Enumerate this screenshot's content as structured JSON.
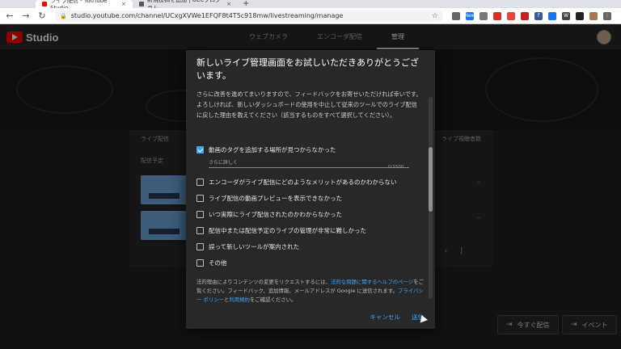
{
  "browser": {
    "tabs": [
      {
        "title": "ライブ配信 - YouTube Studio",
        "favicon_color": "#ff0000"
      },
      {
        "title": "新規投稿を追加 | UECプログラム",
        "favicon_color": "#555555"
      }
    ],
    "url": "studio.youtube.com/channel/UCxgXVWe1EFQF8t4T5c918mw/livestreaming/manage",
    "extension_icons": [
      {
        "name": "camera-icon",
        "color": "#666666",
        "text": ""
      },
      {
        "name": "new-badge-icon",
        "color": "#1a73e8",
        "text": "New"
      },
      {
        "name": "screenshot-icon",
        "color": "#777777",
        "text": ""
      },
      {
        "name": "red-ext-icon",
        "color": "#d93025",
        "text": ""
      },
      {
        "name": "tag-icon",
        "color": "#e8453c",
        "text": ""
      },
      {
        "name": "ext-red-square-icon",
        "color": "#c5221f",
        "text": ""
      },
      {
        "name": "facebook-icon",
        "color": "#3b5998",
        "text": "f"
      },
      {
        "name": "blue-circle-icon",
        "color": "#1a73e8",
        "text": ""
      },
      {
        "name": "w-icon",
        "color": "#444444",
        "text": "W"
      },
      {
        "name": "qr-icon",
        "color": "#222222",
        "text": ""
      },
      {
        "name": "profile-icon",
        "color": "#a47a56",
        "text": ""
      },
      {
        "name": "menu-icon",
        "color": "#666666",
        "text": "⋮"
      }
    ]
  },
  "studio": {
    "logo_text": "Studio",
    "tabs": [
      {
        "label": "ウェブカメラ",
        "selected": false
      },
      {
        "label": "エンコーダ配信",
        "selected": false
      },
      {
        "label": "管理",
        "selected": true
      }
    ]
  },
  "table": {
    "header_left": "ライブ配信",
    "header_right": "ライブ視聴者数",
    "section_label": "配信予定",
    "rows": [
      {
        "viewers": "–"
      },
      {
        "viewers": "–"
      }
    ]
  },
  "bottom_buttons": {
    "stream_now": "今すぐ配信",
    "event": "イベント"
  },
  "dialog": {
    "title": "新しいライブ管理画面をお試しいただきありがとうございます。",
    "intro": "さらに改善を進めてまいりますので、フィードバックをお寄せいただければ幸いです。よろしければ、新しいダッシュボードの使用を中止して従来のツールでのライブ配信に戻した理由を教えてください（該当するものをすべて選択してください）。",
    "options": [
      {
        "label": "動画のタグを追加する場所が見つからなかった",
        "checked": true
      },
      {
        "label": "エンコーダがライブ配信にどのようなメリットがあるのかわからない",
        "checked": false
      },
      {
        "label": "ライブ配信の動画プレビューを表示できなかった",
        "checked": false
      },
      {
        "label": "いつ実際にライブ配信されたのかわからなかった",
        "checked": false
      },
      {
        "label": "配信中または配信予定のライブの管理が非常に難しかった",
        "checked": false
      },
      {
        "label": "誤って新しいツールが案内された",
        "checked": false
      },
      {
        "label": "その他",
        "checked": false
      }
    ],
    "detail_placeholder": "さらに詳しく",
    "char_counter": "0/1500",
    "legal": {
      "part1": "法的理由によりコンテンツの変更をリクエストするには、",
      "link1": "法的な問題に関するヘルプのページ",
      "part2": "をご覧ください。フィードバック、追加情報、メールアドレスが Google に送信されます。",
      "link2": "プライバシー ポリシー",
      "part3": "と",
      "link3": "利用規約",
      "part4": "をご確認ください。"
    },
    "cancel_label": "キャンセル",
    "submit_label": "送信"
  }
}
